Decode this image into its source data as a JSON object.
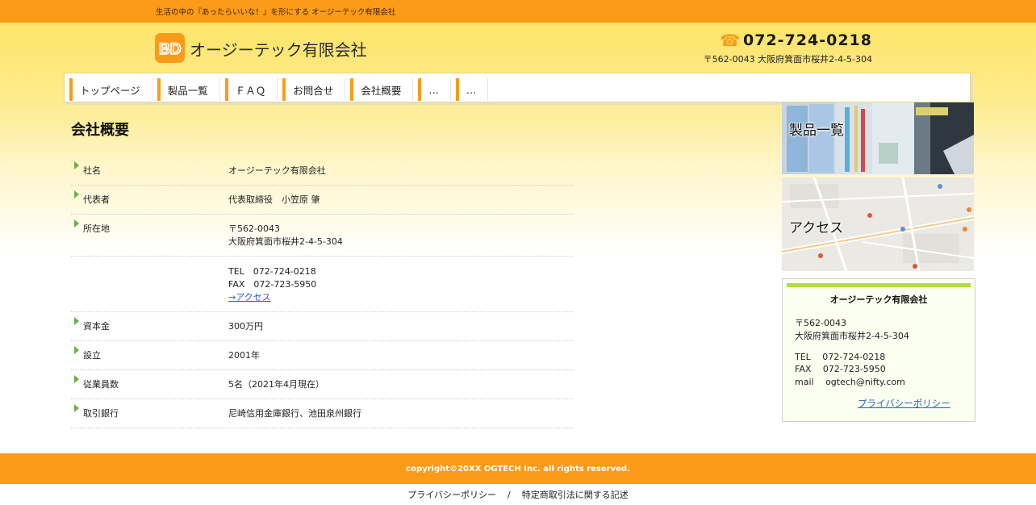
{
  "topbar": {
    "tagline": "生活の中の『あったらいいな！』を形にする オージーテック有限会社"
  },
  "header": {
    "logo_text": "BD",
    "company_name": "オージーテック有限会社",
    "phone": "072-724-0218",
    "phone_icon": "telephone-icon",
    "address": "〒562-0043 大阪府箕面市桜井2-4-5-304"
  },
  "nav": {
    "items": [
      {
        "label": "トップページ"
      },
      {
        "label": "製品一覧"
      },
      {
        "label": "ＦＡＱ"
      },
      {
        "label": "お問合せ"
      },
      {
        "label": "会社概要"
      },
      {
        "label": "…"
      },
      {
        "label": "…"
      }
    ]
  },
  "main": {
    "title": "会社概要",
    "rows": [
      {
        "label": "社名",
        "lines": [
          "オージーテック有限会社"
        ]
      },
      {
        "label": "代表者",
        "lines": [
          "代表取締役　小笠原 肇"
        ]
      },
      {
        "label": "所在地",
        "lines": [
          "〒562-0043",
          "大阪府箕面市桜井2-4-5-304"
        ]
      },
      {
        "label": "",
        "lines": [
          "TEL　072-724-0218",
          "FAX　072-723-5950"
        ],
        "link": "→アクセス"
      },
      {
        "label": "資本金",
        "lines": [
          "300万円"
        ]
      },
      {
        "label": "設立",
        "lines": [
          "2001年"
        ]
      },
      {
        "label": "従業員数",
        "lines": [
          "5名（2021年4月現在）"
        ]
      },
      {
        "label": "取引銀行",
        "lines": [
          "尼崎信用金庫銀行、池田泉州銀行"
        ]
      }
    ]
  },
  "sidebar": {
    "banner_products": "製品一覧",
    "banner_access": "アクセス",
    "box": {
      "title": "オージーテック有限会社",
      "postal": "〒562-0043",
      "address": "大阪府箕面市桜井2-4-5-304",
      "tel": "TEL　 072-724-0218",
      "fax": "FAX　 072-723-5950",
      "mail": "mail　 ogtech@nifty.com",
      "privacy_link": "プライバシーポリシー"
    }
  },
  "footer": {
    "copyright": "copyright©20XX OGTECH Inc. all rights reserved.",
    "link_privacy": "プライバシーポリシー",
    "separator": "/",
    "link_commerce": "特定商取引法に関する記述"
  },
  "colors": {
    "accent_orange": "#fb9b17",
    "arrow_green": "#6ab04c",
    "box_green": "#b4d94c"
  }
}
